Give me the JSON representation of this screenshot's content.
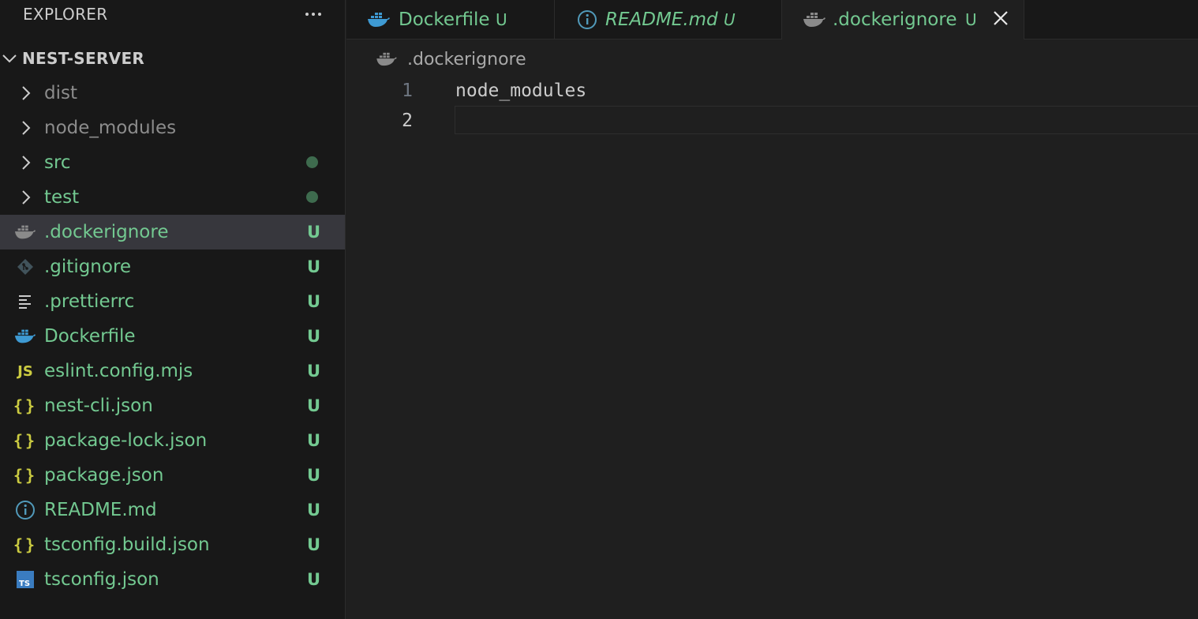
{
  "explorer": {
    "title": "EXPLORER",
    "more_icon": "ellipsis-icon",
    "project": "NEST-SERVER",
    "items": [
      {
        "label": "dist",
        "type": "folder",
        "status": "ignored",
        "decoration": ""
      },
      {
        "label": "node_modules",
        "type": "folder",
        "status": "ignored",
        "decoration": ""
      },
      {
        "label": "src",
        "type": "folder",
        "status": "untracked",
        "decoration": "dot"
      },
      {
        "label": "test",
        "type": "folder",
        "status": "untracked",
        "decoration": "dot"
      },
      {
        "label": ".dockerignore",
        "type": "file",
        "icon": "docker-icon",
        "status": "untracked",
        "decoration": "U",
        "selected": true
      },
      {
        "label": ".gitignore",
        "type": "file",
        "icon": "git-icon",
        "status": "untracked",
        "decoration": "U"
      },
      {
        "label": ".prettierrc",
        "type": "file",
        "icon": "lines-icon",
        "status": "untracked",
        "decoration": "U"
      },
      {
        "label": "Dockerfile",
        "type": "file",
        "icon": "docker-icon",
        "status": "untracked",
        "decoration": "U"
      },
      {
        "label": "eslint.config.mjs",
        "type": "file",
        "icon": "js-icon",
        "icon_text": "JS",
        "status": "untracked",
        "decoration": "U"
      },
      {
        "label": "nest-cli.json",
        "type": "file",
        "icon": "json-icon",
        "icon_text": "{}",
        "status": "untracked",
        "decoration": "U"
      },
      {
        "label": "package-lock.json",
        "type": "file",
        "icon": "json-icon",
        "icon_text": "{}",
        "status": "untracked",
        "decoration": "U"
      },
      {
        "label": "package.json",
        "type": "file",
        "icon": "json-icon",
        "icon_text": "{}",
        "status": "untracked",
        "decoration": "U"
      },
      {
        "label": "README.md",
        "type": "file",
        "icon": "info-icon",
        "status": "untracked",
        "decoration": "U"
      },
      {
        "label": "tsconfig.build.json",
        "type": "file",
        "icon": "json-icon",
        "icon_text": "{}",
        "status": "untracked",
        "decoration": "U"
      },
      {
        "label": "tsconfig.json",
        "type": "file",
        "icon": "ts-icon",
        "icon_text": "TS",
        "status": "untracked",
        "decoration": "U"
      }
    ]
  },
  "tabs": [
    {
      "label": "Dockerfile",
      "icon": "docker-icon",
      "decoration": "U",
      "active": false
    },
    {
      "label": "README.md",
      "icon": "info-icon",
      "decoration": "U",
      "active": false,
      "italic": true
    },
    {
      "label": ".dockerignore",
      "icon": "docker-icon",
      "decoration": "U",
      "active": true
    }
  ],
  "breadcrumb": {
    "label": ".dockerignore",
    "icon": "docker-icon"
  },
  "editor": {
    "lines": [
      {
        "number": "1",
        "text": "node_modules"
      },
      {
        "number": "2",
        "text": ""
      }
    ],
    "current_line": 2
  },
  "colors": {
    "untracked": "#73c991",
    "ignored": "#8c8c8c",
    "docker_blue": "#3e9ad3",
    "json_yellow": "#cbcb41",
    "ts_blue": "#3a7cc0",
    "info_blue": "#519aba"
  }
}
